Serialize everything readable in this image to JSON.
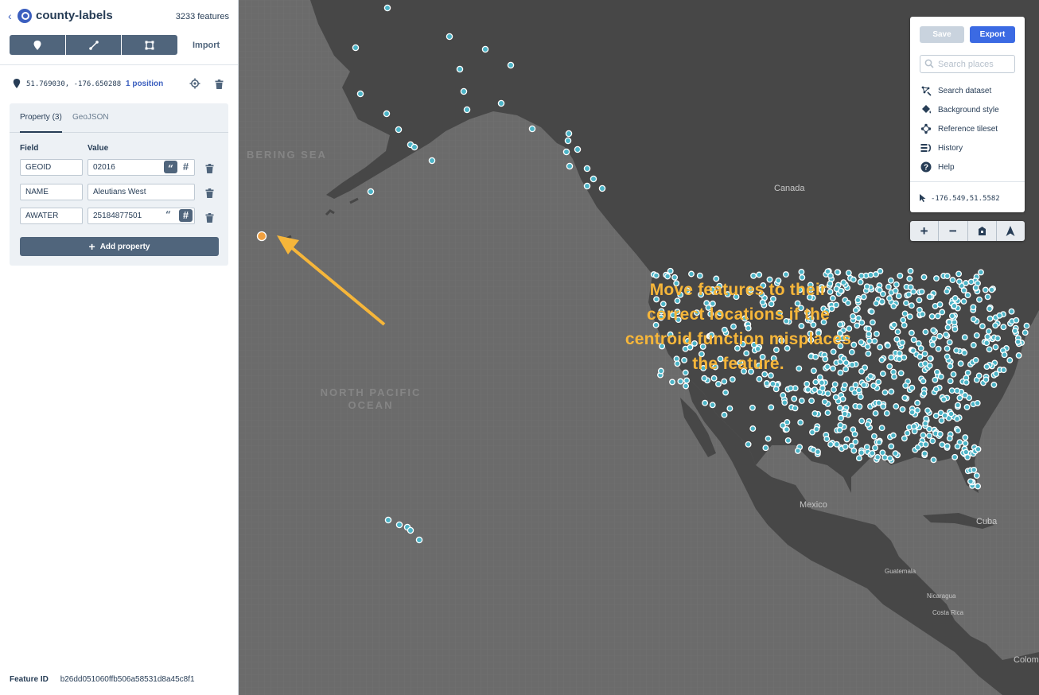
{
  "header": {
    "title": "county-labels",
    "feature_count": "3233 features",
    "import_label": "Import"
  },
  "tools": [
    "point-tool",
    "line-tool",
    "polygon-tool"
  ],
  "feature": {
    "coordinates": "51.769030, -176.650288",
    "position_link": "1 position"
  },
  "properties": {
    "tab_property": "Property (3)",
    "tab_geojson": "GeoJSON",
    "field_header": "Field",
    "value_header": "Value",
    "rows": [
      {
        "field": "GEOID",
        "value": "02016",
        "type": "string"
      },
      {
        "field": "NAME",
        "value": "Aleutians West",
        "type": "string"
      },
      {
        "field": "AWATER",
        "value": "25184877501",
        "type": "number"
      }
    ],
    "add_label": "Add property"
  },
  "footer": {
    "label": "Feature ID",
    "value": "b26dd051060ffb506a58531d8a45c8f1"
  },
  "controls": {
    "save_label": "Save",
    "export_label": "Export",
    "search_placeholder": "Search places",
    "menu": [
      "Search dataset",
      "Background style",
      "Reference tileset",
      "History",
      "Help"
    ],
    "cursor_coords": "-176.549,51.5582"
  },
  "map": {
    "sea_label": "BERING SEA",
    "ocean_label_1": "NORTH PACIFIC",
    "ocean_label_2": "OCEAN",
    "places": [
      "Canada",
      "Mexico",
      "Cuba",
      "Guatemala",
      "Nicaragua",
      "Costa Rica",
      "Colom"
    ],
    "annotation": "Move features to their correct locations if the centroid function misplaces the feature."
  },
  "colors": {
    "accent": "#3b6ae3",
    "feature": "#4cb4c7",
    "selected": "#f0a040",
    "annotation": "#f6b63a",
    "land": "#474747",
    "water": "#6b6b6b"
  }
}
